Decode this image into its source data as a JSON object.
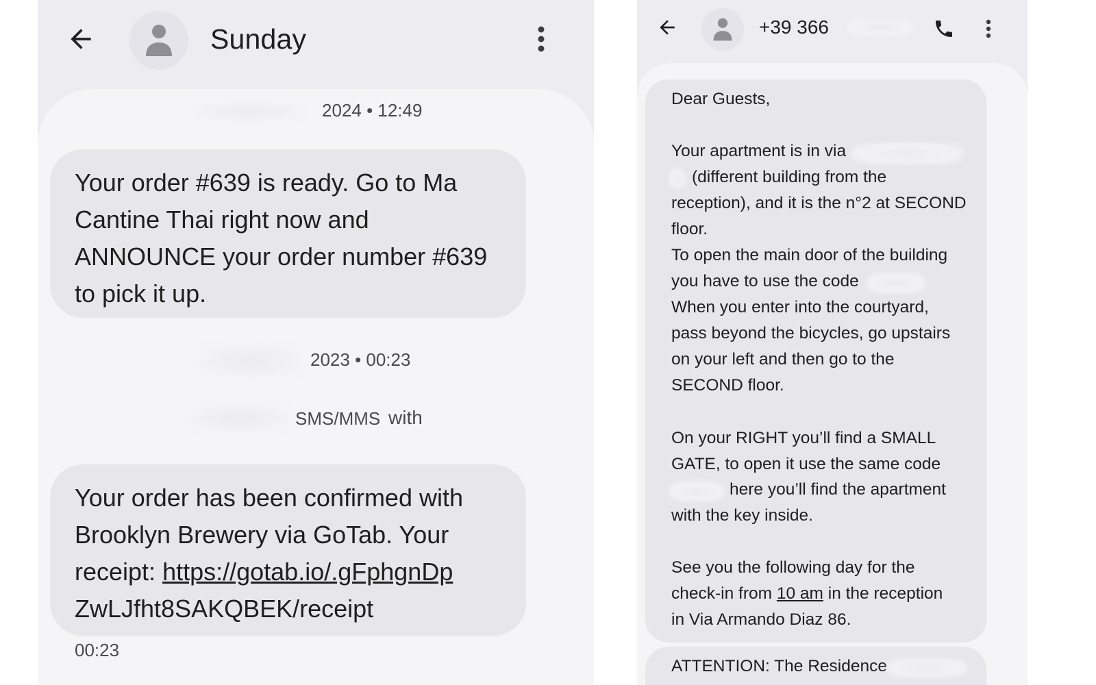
{
  "left": {
    "header": {
      "title": "Sunday",
      "back_icon": "arrow-left-icon",
      "avatar_icon": "person-icon",
      "more_icon": "more-vert-icon"
    },
    "timestamp_1": "2024 • 12:49",
    "message_1": {
      "lines": [
        "Your order #639 is ready. Go to Ma",
        "Cantine Thai right now and",
        "ANNOUNCE your order number #639",
        "to pick it up."
      ]
    },
    "timestamp_2": "2023 • 00:23",
    "sms_label": "SMS/MMS",
    "sms_with": "with",
    "message_2": {
      "line_1": "Your order has been confirmed with",
      "line_2": "Brooklyn Brewery via GoTab. Your",
      "line_3_prefix": "receipt: ",
      "link_part_1": "https://gotab.io/.gFphgnDp",
      "line_4": "ZwLJfht8SAKQBEK/receipt"
    },
    "time_under": "00:23"
  },
  "right": {
    "header": {
      "title": "+39 366",
      "back_icon": "arrow-left-icon",
      "avatar_icon": "person-icon",
      "phone_icon": "phone-icon",
      "more_icon": "more-vert-icon"
    },
    "message": {
      "l01": "Dear Guests,",
      "l02": "Your apartment is in via",
      "l03": "(different building from the",
      "l04": "reception), and it is the n°2 at SECOND",
      "l05": "floor.",
      "l06": "To open the main door of the building",
      "l07": "you have to use the code",
      "l08": "When you enter into the courtyard,",
      "l09": "pass beyond the bicycles, go upstairs",
      "l10": "on your left and then go to the",
      "l11": "SECOND floor.",
      "l12": "On your RIGHT you’ll find a SMALL",
      "l13": "GATE, to open it use the same code",
      "l14": "here you’ll find the apartment",
      "l15": "with the key inside.",
      "l16": "See you the following day for the",
      "l17_prefix": "check-in from ",
      "l17_link": "10 am",
      "l17_suffix": " in the reception",
      "l18": "in Via Armando Diaz 86.",
      "next_message": "ATTENTION: The Residence"
    }
  }
}
